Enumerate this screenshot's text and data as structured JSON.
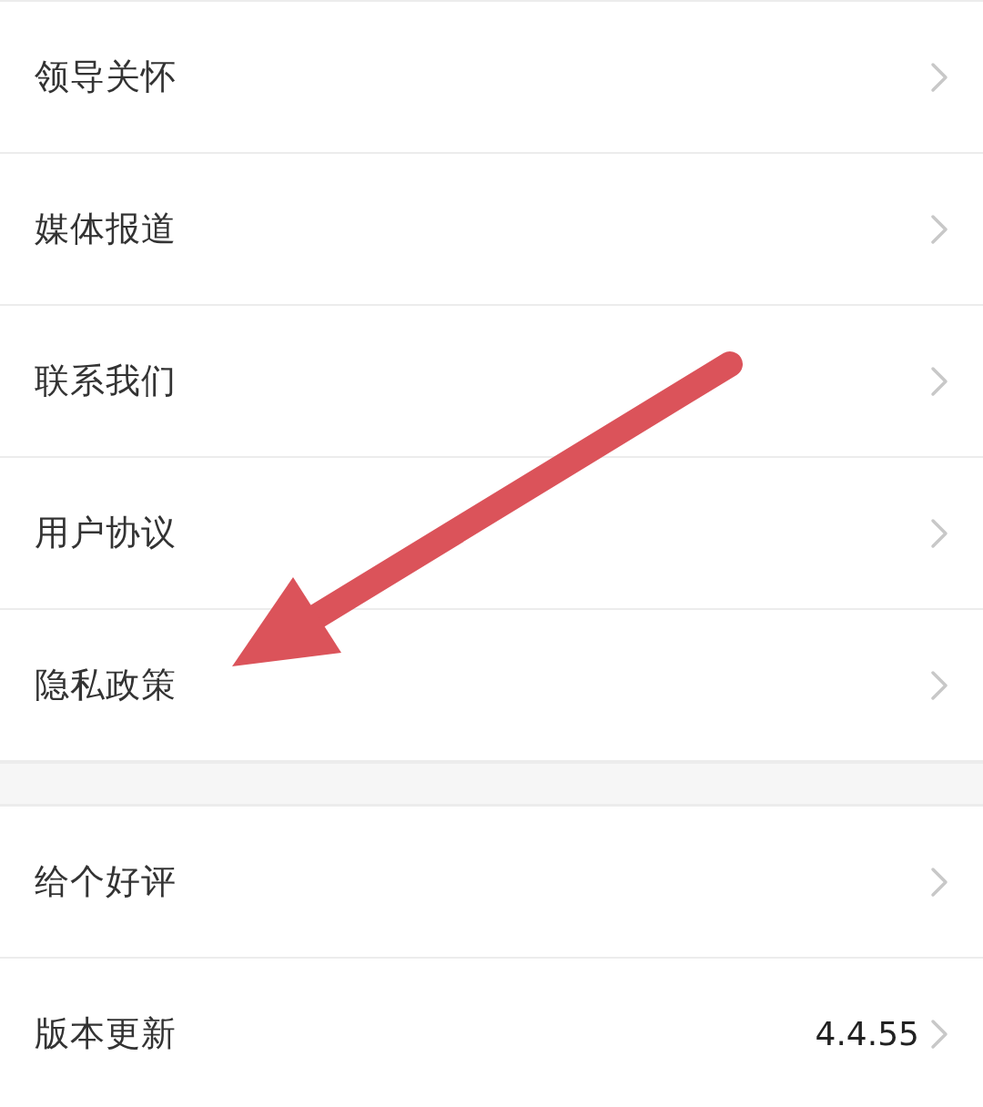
{
  "sections": [
    {
      "items": [
        {
          "label": "领导关怀"
        },
        {
          "label": "媒体报道"
        },
        {
          "label": "联系我们"
        },
        {
          "label": "用户协议"
        },
        {
          "label": "隐私政策"
        }
      ]
    },
    {
      "items": [
        {
          "label": "给个好评"
        },
        {
          "label": "版本更新",
          "value": "4.4.55"
        }
      ]
    }
  ]
}
